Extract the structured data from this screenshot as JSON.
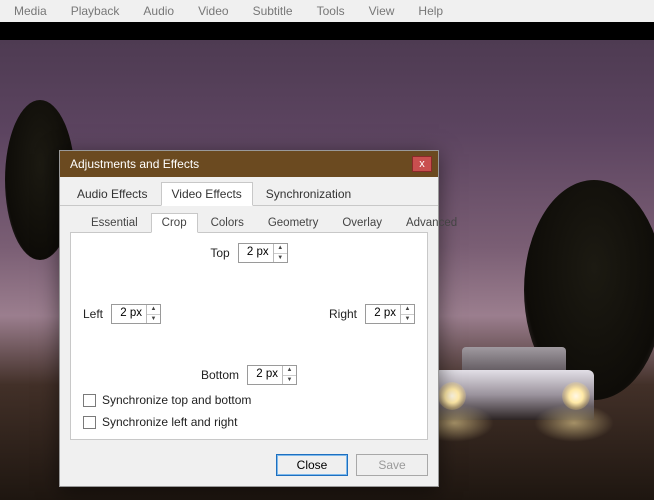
{
  "menu": {
    "media": "Media",
    "playback": "Playback",
    "audio": "Audio",
    "video": "Video",
    "subtitle": "Subtitle",
    "tools": "Tools",
    "view": "View",
    "help": "Help"
  },
  "dialog": {
    "title": "Adjustments and Effects",
    "tabs": {
      "audio_effects": "Audio Effects",
      "video_effects": "Video Effects",
      "synchronization": "Synchronization"
    },
    "subtabs": {
      "essential": "Essential",
      "crop": "Crop",
      "colors": "Colors",
      "geometry": "Geometry",
      "overlay": "Overlay",
      "advanced": "Advanced"
    },
    "crop": {
      "top_label": "Top",
      "left_label": "Left",
      "right_label": "Right",
      "bottom_label": "Bottom",
      "top_value": "2 px",
      "left_value": "2 px",
      "right_value": "2 px",
      "bottom_value": "2 px",
      "sync_tb": "Synchronize top and bottom",
      "sync_lr": "Synchronize left and right"
    },
    "buttons": {
      "close": "Close",
      "save": "Save"
    }
  }
}
